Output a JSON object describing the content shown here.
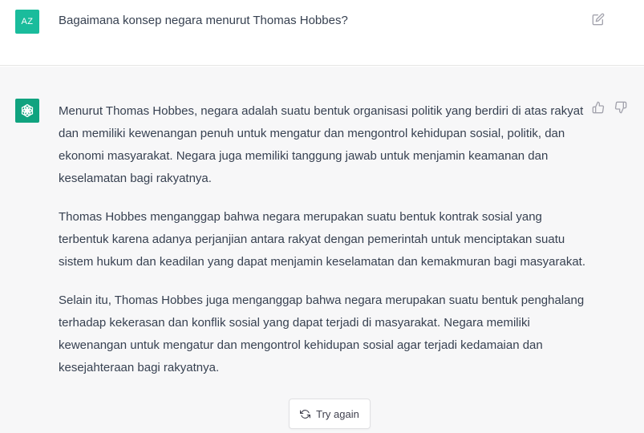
{
  "user_message": {
    "avatar_initials": "AZ",
    "text": "Bagaimana konsep negara menurut Thomas Hobbes?",
    "edit_icon": "edit-icon"
  },
  "assistant_message": {
    "avatar_icon": "openai-logo-icon",
    "paragraphs": [
      "Menurut Thomas Hobbes, negara adalah suatu bentuk organisasi politik yang berdiri di atas rakyat dan memiliki kewenangan penuh untuk mengatur dan mengontrol kehidupan sosial, politik, dan ekonomi masyarakat. Negara juga memiliki tanggung jawab untuk menjamin keamanan dan keselamatan bagi rakyatnya.",
      "Thomas Hobbes menganggap bahwa negara merupakan suatu bentuk kontrak sosial yang terbentuk karena adanya perjanjian antara rakyat dengan pemerintah untuk menciptakan suatu sistem hukum dan keadilan yang dapat menjamin keselamatan dan kemakmuran bagi masyarakat.",
      "Selain itu, Thomas Hobbes juga menganggap bahwa negara merupakan suatu bentuk penghalang terhadap kekerasan dan konflik sosial yang dapat terjadi di masyarakat. Negara memiliki kewenangan untuk mengatur dan mengontrol kehidupan sosial agar terjadi kedamaian dan kesejahteraan bagi rakyatnya."
    ],
    "feedback_icons": [
      "thumbs-up-icon",
      "thumbs-down-icon"
    ]
  },
  "try_again": {
    "label": "Try again",
    "icon": "refresh-icon"
  },
  "colors": {
    "user_avatar": "#1abc9c",
    "assistant_avatar": "#10a37f",
    "assistant_background": "#f7f7f8",
    "text": "#374151"
  }
}
